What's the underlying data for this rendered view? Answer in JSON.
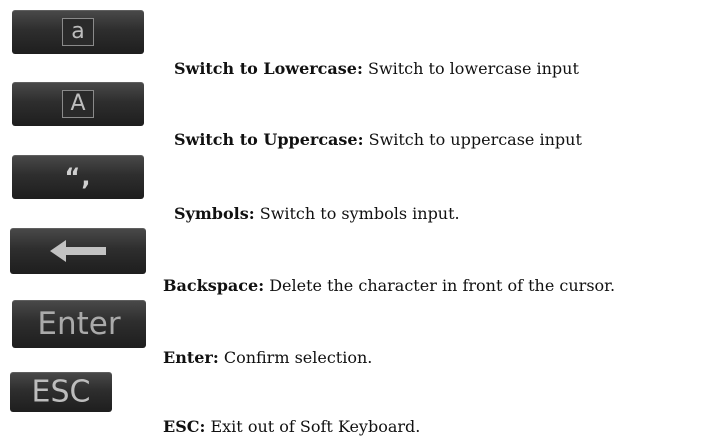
{
  "items": [
    {
      "key_label": "a",
      "icon": "lowercase-a-icon",
      "title": "Switch to Lowercase:",
      "text": " Switch to lowercase input"
    },
    {
      "key_label": "A",
      "icon": "uppercase-a-icon",
      "title": "Switch to Uppercase:",
      "text": " Switch to uppercase input"
    },
    {
      "key_label": "“,",
      "icon": "symbols-icon",
      "title": "Symbols:",
      "text": " Switch to symbols input."
    },
    {
      "key_label": "",
      "icon": "left-arrow-icon",
      "title": "Backspace:",
      "text": " Delete the character in front of the cursor."
    },
    {
      "key_label": "Enter",
      "icon": "enter-key",
      "title": "Enter:",
      "text": " Confirm selection."
    },
    {
      "key_label": "ESC",
      "icon": "esc-key",
      "title": "ESC:",
      "text": " Exit out of Soft Keyboard."
    }
  ]
}
